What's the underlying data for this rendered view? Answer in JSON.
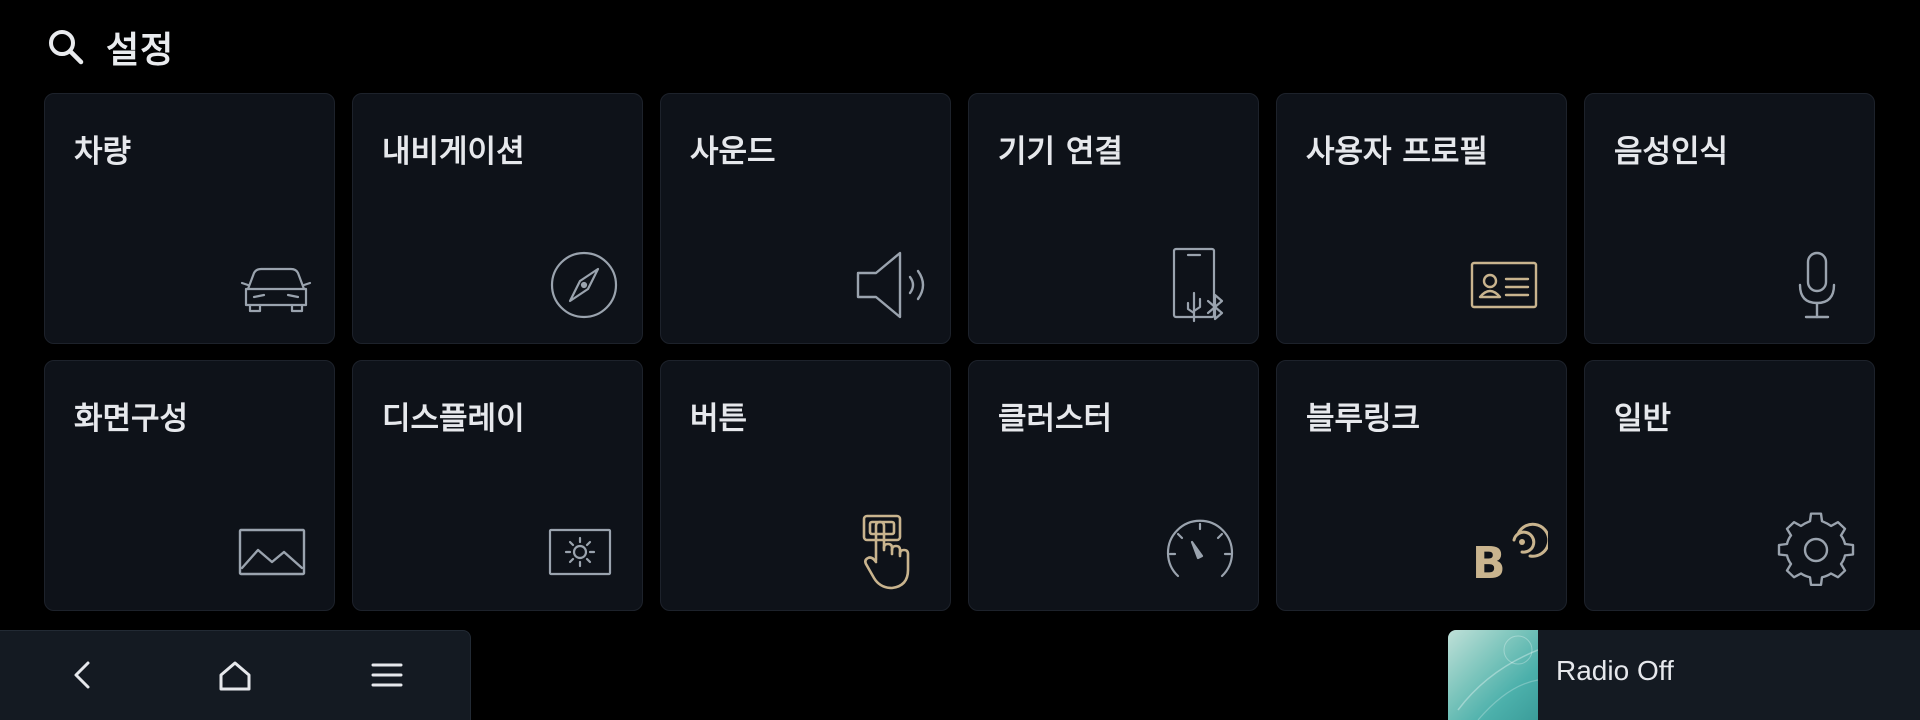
{
  "header": {
    "title": "설정",
    "search_icon": "search-icon"
  },
  "tiles": [
    {
      "id": "vehicle",
      "label": "차량",
      "icon": "car-icon",
      "icon_color": "#9aa3ae"
    },
    {
      "id": "navigation",
      "label": "내비게이션",
      "icon": "compass-icon",
      "icon_color": "#9aa3ae"
    },
    {
      "id": "sound",
      "label": "사운드",
      "icon": "speaker-icon",
      "icon_color": "#9aa3ae"
    },
    {
      "id": "device-connection",
      "label": "기기 연결",
      "icon": "phone-usb-bluetooth-icon",
      "icon_color": "#9aa3ae"
    },
    {
      "id": "user-profile",
      "label": "사용자 프로필",
      "icon": "id-card-icon",
      "icon_color": "#c9b48e"
    },
    {
      "id": "voice-recognition",
      "label": "음성인식",
      "icon": "microphone-icon",
      "icon_color": "#9aa3ae"
    },
    {
      "id": "screen-layout",
      "label": "화면구성",
      "icon": "image-icon",
      "icon_color": "#9aa3ae"
    },
    {
      "id": "display",
      "label": "디스플레이",
      "icon": "brightness-icon",
      "icon_color": "#9aa3ae"
    },
    {
      "id": "buttons",
      "label": "버튼",
      "icon": "hand-press-icon",
      "icon_color": "#c9b48e"
    },
    {
      "id": "cluster",
      "label": "클러스터",
      "icon": "gauge-icon",
      "icon_color": "#9aa3ae"
    },
    {
      "id": "bluelink",
      "label": "블루링크",
      "icon": "bluelink-icon",
      "icon_color": "#c9b48e"
    },
    {
      "id": "general",
      "label": "일반",
      "icon": "gear-icon",
      "icon_color": "#9aa3ae"
    }
  ],
  "navbar": {
    "back_icon": "back-icon",
    "home_icon": "home-icon",
    "menu_icon": "menu-icon"
  },
  "media": {
    "status": "Radio Off"
  },
  "colors": {
    "background": "#000000",
    "tile": "#0e1219",
    "accent": "#c9b48e",
    "icon": "#9aa3ae"
  }
}
